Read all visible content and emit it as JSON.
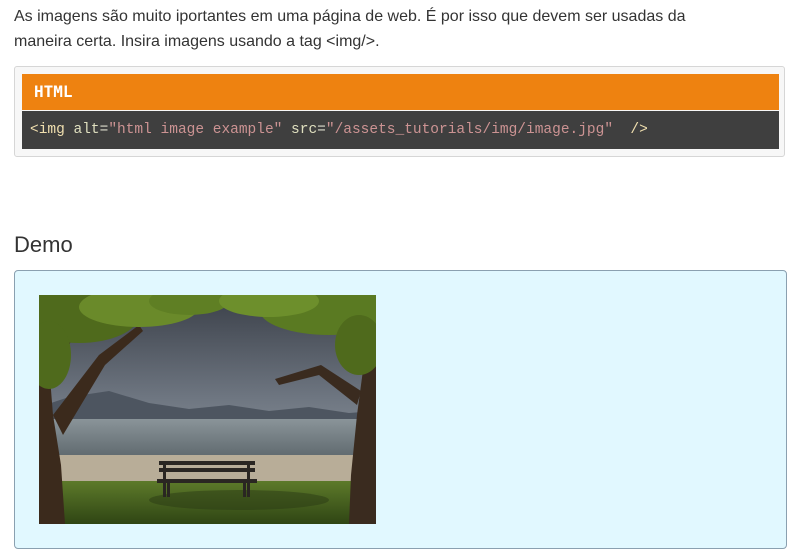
{
  "intro": {
    "line1": "As imagens são muito iportantes em uma página de web. É por isso que devem ser usadas da",
    "line2": "maneira certa. Insira imagens usando a tag <img/>."
  },
  "code": {
    "language": "HTML",
    "tag_open": "<img",
    "attr1_name": " alt",
    "attr1_value": "\"html image example\"",
    "attr2_name": " src",
    "attr2_value": "\"/assets_tutorials/img/image.jpg\"",
    "tag_close": "  />",
    "colors": {
      "header": "#ee8210",
      "body": "#3f3f3f"
    }
  },
  "demo": {
    "title": "Demo",
    "image_alt": "html image example",
    "background_color": "#e1f8ff"
  }
}
